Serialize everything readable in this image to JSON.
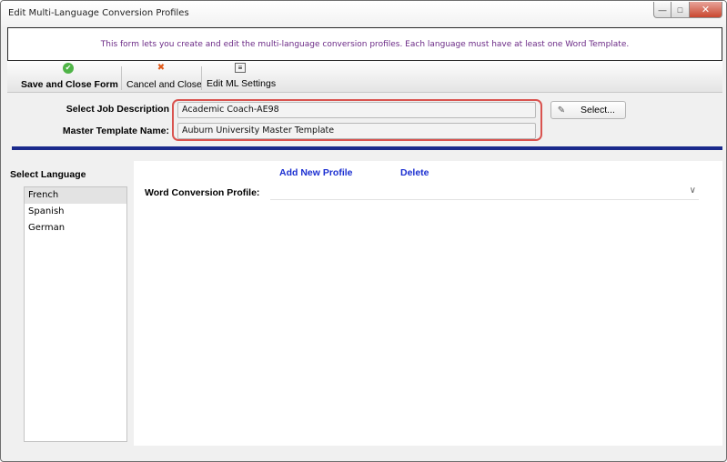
{
  "window": {
    "title": "Edit Multi-Language Conversion Profiles",
    "controls": {
      "minimize": "—",
      "maximize": "□",
      "close": "✕"
    }
  },
  "info_banner": {
    "text": "This form lets you create and edit the multi-language conversion profiles. Each language must have at least one Word Template."
  },
  "toolbar": {
    "items": [
      {
        "label": "Save and Close Form",
        "icon": "check-circle-icon",
        "glyph": "✔"
      },
      {
        "label": "Cancel and Close",
        "icon": "x-icon",
        "glyph": "✖"
      },
      {
        "label": "Edit ML Settings",
        "icon": "settings-document-icon",
        "glyph": "≡"
      }
    ]
  },
  "job": {
    "label": "Select Job Description",
    "value": "Academic Coach-AE98",
    "select_button": "Select...",
    "select_icon": "pencil-icon",
    "select_glyph": "✎"
  },
  "master_template": {
    "label": "Master Template Name:",
    "value": "Auburn University Master Template"
  },
  "language_panel": {
    "title": "Select Language",
    "languages": [
      "French",
      "Spanish",
      "German"
    ],
    "selected": "French"
  },
  "profile_panel": {
    "add_link": "Add New Profile",
    "delete_link": "Delete",
    "word_profile_label": "Word Conversion Profile:",
    "word_profile_value": "",
    "dropdown_icon": "chevron-down-icon",
    "dropdown_glyph": "∨"
  },
  "colors": {
    "info_text": "#6b2a86",
    "link": "#1b2fd1",
    "divider": "#1a2a8c",
    "highlight": "#d9534f"
  }
}
